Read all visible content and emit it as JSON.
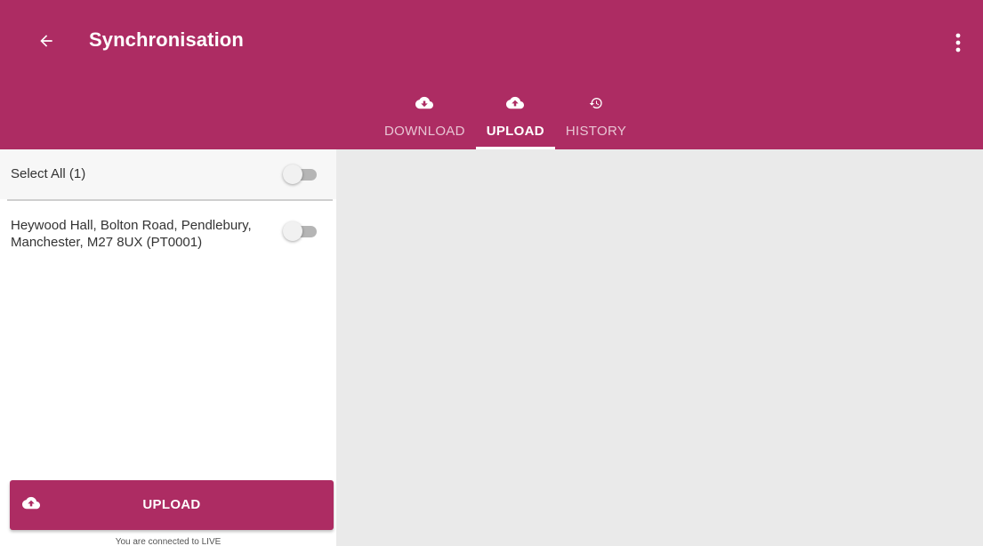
{
  "appbar": {
    "title": "Synchronisation",
    "back_icon": "arrow-back-icon",
    "menu_icon": "more-vert-icon",
    "background_color": "#ad2c63"
  },
  "tabs": [
    {
      "label": "DOWNLOAD",
      "icon": "cloud-download-icon",
      "active": false
    },
    {
      "label": "UPLOAD",
      "icon": "cloud-upload-icon",
      "active": true
    },
    {
      "label": "HISTORY",
      "icon": "history-icon",
      "active": false
    }
  ],
  "list": {
    "select_all_label": "Select All (1)",
    "select_all_checked": false,
    "items": [
      {
        "label": "Heywood Hall, Bolton Road, Pendlebury, Manchester, M27 8UX (PT0001)",
        "checked": false
      }
    ]
  },
  "upload_button": {
    "label": "UPLOAD",
    "icon": "cloud-upload-icon"
  },
  "status": {
    "connection_text": "You are connected to LIVE"
  }
}
